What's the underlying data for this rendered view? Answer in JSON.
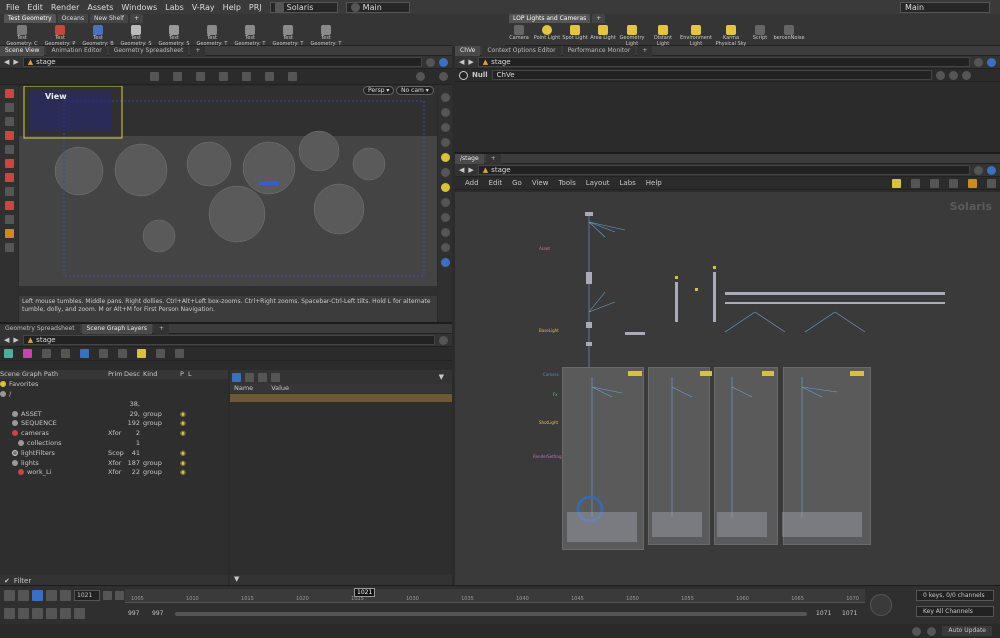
{
  "menubar": {
    "items": [
      "File",
      "Edit",
      "Render",
      "Assets",
      "Windows",
      "Labs",
      "V-Ray",
      "Help",
      "PRJ"
    ],
    "desktop": "Solaris",
    "context": "Main",
    "right_context": "Main"
  },
  "shelf_left": {
    "tabs": [
      "Test Geometry",
      "Oceans",
      "New Shelf"
    ],
    "tools": [
      "Test Geometry: C",
      "Test Geometry: P",
      "Test Geometry: B",
      "Test Geometry: S",
      "Test Geometry: S",
      "Test Geometry: T",
      "Test Geometry: T",
      "Test Geometry: T",
      "Test Geometry: T"
    ]
  },
  "shelf_right": {
    "tabs": [
      "LOP Lights and Cameras"
    ],
    "tools": [
      "Camera",
      "Point Light",
      "Spot Light",
      "Area Light",
      "Geometry Light",
      "Distant Light",
      "Environment Light",
      "Karma Physical Sky",
      "Script",
      "bercenNoise"
    ]
  },
  "scene_view": {
    "tabs": [
      "Scene View",
      "Animation Editor",
      "Geometry Spreadsheet"
    ],
    "path": "stage",
    "view_label": "View",
    "persp": "Persp ▾",
    "camera": "No cam ▾",
    "hint": "Left mouse tumbles. Middle pans. Right dollies. Ctrl+Alt+Left box-zooms. Ctrl+Right zooms. Spacebar-Ctrl-Left tilts. Hold L for alternate tumble, dolly, and zoom. M or Alt+M for First Person Navigation."
  },
  "scene_graph": {
    "tabs": [
      "Geometry Spreadsheet",
      "Scene Graph Layers"
    ],
    "path": "stage",
    "headers": [
      "Scene Graph Path",
      "Prim",
      "Desc",
      "Kind",
      "P",
      "L"
    ],
    "rows": [
      {
        "name": "Favorites",
        "prim": "",
        "desc": "",
        "kind": ""
      },
      {
        "name": "/",
        "prim": "",
        "desc": "",
        "kind": ""
      },
      {
        "name": "",
        "prim": "",
        "desc": "38,",
        "kind": ""
      },
      {
        "name": "ASSET",
        "prim": "",
        "desc": "29,",
        "kind": "group"
      },
      {
        "name": "SEQUENCE",
        "prim": "",
        "desc": "192",
        "kind": "group"
      },
      {
        "name": "cameras",
        "prim": "Xfor",
        "desc": "2",
        "kind": ""
      },
      {
        "name": "collections",
        "prim": "",
        "desc": "1",
        "kind": ""
      },
      {
        "name": "lightFilters",
        "prim": "Scop",
        "desc": "41",
        "kind": ""
      },
      {
        "name": "lights",
        "prim": "Xfor",
        "desc": "187",
        "kind": "group"
      },
      {
        "name": "work_Li",
        "prim": "Xfor",
        "desc": "22",
        "kind": "group"
      }
    ],
    "filter": "Filter",
    "attr_headers": [
      "Name",
      "Value"
    ]
  },
  "chve": {
    "tabs": [
      "ChVe",
      "Context Options Editor",
      "Performance Monitor"
    ],
    "path": "stage",
    "node_type": "Null",
    "node_name": "ChVe"
  },
  "network": {
    "tab": "/stage",
    "path": "stage",
    "menu": [
      "Add",
      "Edit",
      "Go",
      "View",
      "Tools",
      "Layout",
      "Labs",
      "Help"
    ],
    "watermark": "Solaris",
    "labels": [
      "Asset",
      "BaseLight",
      "Camera",
      "Fx",
      "ShotLight",
      "RenderSetting"
    ]
  },
  "timeline": {
    "frame": "1021",
    "current": "1021",
    "start": "997",
    "start2": "997",
    "end": "1071",
    "end2": "1071",
    "ticks": [
      "1005",
      "1010",
      "1015",
      "1020",
      "1025",
      "1030",
      "1035",
      "1040",
      "1045",
      "1050",
      "1055",
      "1060",
      "1065",
      "1070"
    ],
    "keys": "0 keys, 0/0 channels",
    "key_all": "Key All Channels",
    "auto_update": "Auto Update"
  }
}
